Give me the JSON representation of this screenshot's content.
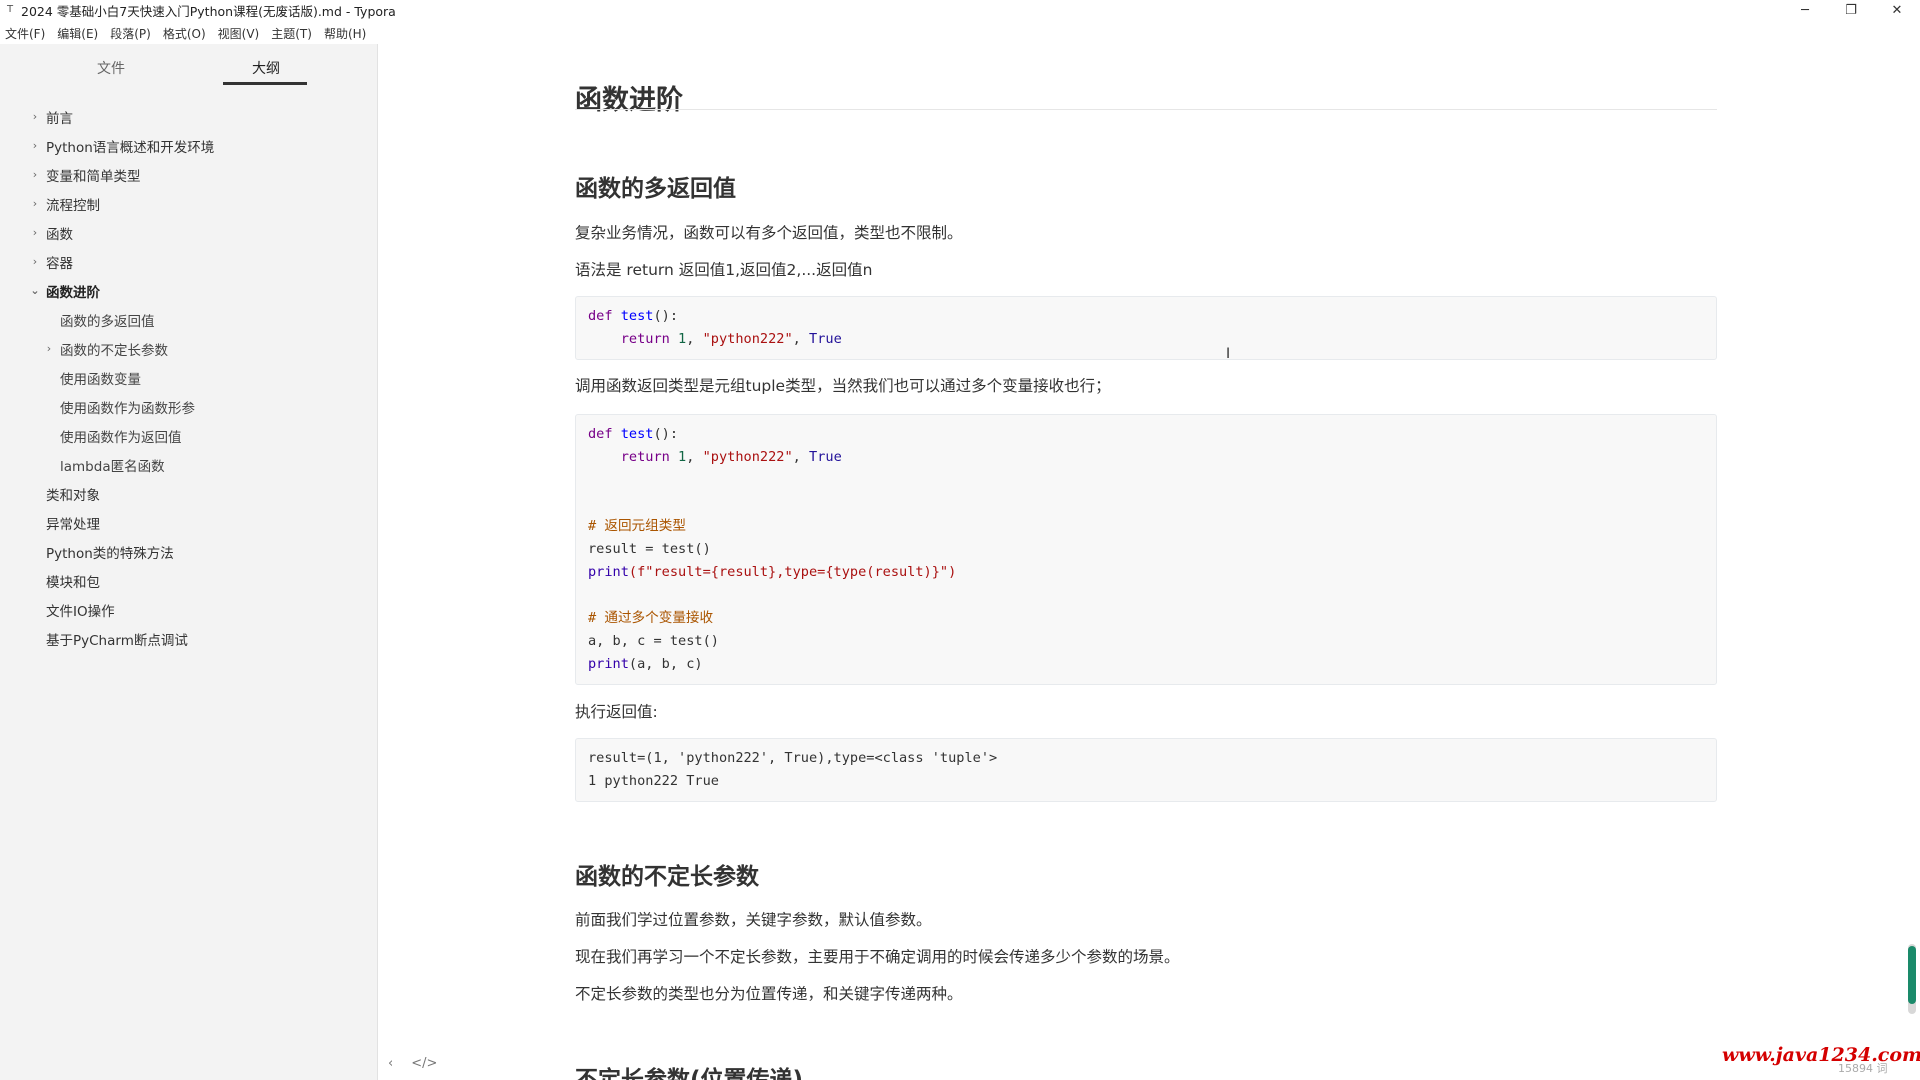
{
  "window": {
    "title": "2024 零基础小白7天快速入门Python课程(无废话版).md - Typora",
    "app_icon": "T",
    "minimize": "─",
    "restore": "❐",
    "close": "✕"
  },
  "menu": [
    "文件(F)",
    "编辑(E)",
    "段落(P)",
    "格式(O)",
    "视图(V)",
    "主题(T)",
    "帮助(H)"
  ],
  "sidebar": {
    "tab_files": "文件",
    "tab_outline": "大纲",
    "outline": [
      {
        "label": "前言",
        "level": 1,
        "arrow": "›"
      },
      {
        "label": "Python语言概述和开发环境",
        "level": 1,
        "arrow": "›"
      },
      {
        "label": "变量和简单类型",
        "level": 1,
        "arrow": "›"
      },
      {
        "label": "流程控制",
        "level": 1,
        "arrow": "›"
      },
      {
        "label": "函数",
        "level": 1,
        "arrow": "›"
      },
      {
        "label": "容器",
        "level": 1,
        "arrow": "›"
      },
      {
        "label": "函数进阶",
        "level": 1,
        "arrow": "⌄",
        "active": true
      },
      {
        "label": "函数的多返回值",
        "level": 2,
        "arrow": ""
      },
      {
        "label": "函数的不定长参数",
        "level": 2,
        "arrow": "›"
      },
      {
        "label": "使用函数变量",
        "level": 2,
        "arrow": ""
      },
      {
        "label": "使用函数作为函数形参",
        "level": 2,
        "arrow": ""
      },
      {
        "label": "使用函数作为返回值",
        "level": 2,
        "arrow": ""
      },
      {
        "label": "lambda匿名函数",
        "level": 2,
        "arrow": ""
      },
      {
        "label": "类和对象",
        "level": 1,
        "arrow": ""
      },
      {
        "label": "异常处理",
        "level": 1,
        "arrow": ""
      },
      {
        "label": "Python类的特殊方法",
        "level": 1,
        "arrow": ""
      },
      {
        "label": "模块和包",
        "level": 1,
        "arrow": ""
      },
      {
        "label": "文件IO操作",
        "level": 1,
        "arrow": ""
      },
      {
        "label": "基于PyCharm断点调试",
        "level": 1,
        "arrow": ""
      }
    ],
    "footer_left": "‹",
    "footer_code": "</>"
  },
  "doc": {
    "h1": "函数进阶",
    "h2_multi_return": "函数的多返回值",
    "p1": "复杂业务情况，函数可以有多个返回值，类型也不限制。",
    "p2": "语法是 return 返回值1,返回值2,...返回值n",
    "code1": {
      "def": "def",
      "fname": "test",
      "sig": "():",
      "ret": "return",
      "num": "1",
      "str": "\"python222\"",
      "atom": "True"
    },
    "p3": "调用函数返回类型是元组tuple类型，当然我们也可以通过多个变量接收也行；",
    "code2": {
      "def": "def",
      "fname": "test",
      "sig": "():",
      "ret": "return",
      "num": "1",
      "str": "\"python222\"",
      "atom": "True",
      "cmt1": "# 返回元组类型",
      "l_result": "result = test()",
      "print": "print",
      "fstr": "(f\"result={result},type={type(result)}\")",
      "cmt2": "# 通过多个变量接收",
      "l_abc": "a, b, c = test()",
      "print2_args": "(a, b, c)"
    },
    "p4": "执行返回值:",
    "output": {
      "line1": "result=(1, 'python222', True),type=<class 'tuple'>",
      "line2": "1 python222 True"
    },
    "h2_varargs": "函数的不定长参数",
    "p5": "前面我们学过位置参数，关键字参数，默认值参数。",
    "p6": "现在我们再学习一个不定长参数，主要用于不确定调用的时候会传递多少个参数的场景。",
    "p7": "不定长参数的类型也分为位置传递，和关键字传递两种。",
    "h2_next": "不定长参数(位置传递)"
  },
  "status": {
    "watermark": "www.java1234.com",
    "wordcount": "15894 词"
  },
  "colors": {
    "sidebar_bg": "#f3f3f3",
    "scroll_thumb": "#1a8a6a",
    "watermark": "#d40000"
  }
}
